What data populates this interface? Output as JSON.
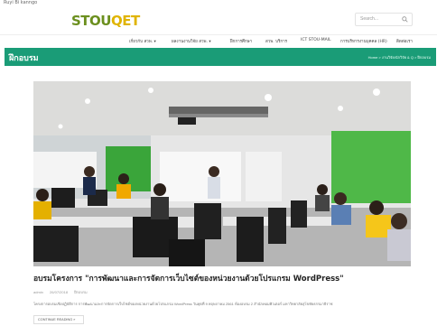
{
  "top_note": "Ruyi Bi kanngo",
  "logo": {
    "part1": "STOU",
    "part2": "QET"
  },
  "search": {
    "placeholder": "Search..."
  },
  "nav": {
    "items": [
      "เกี่ยวกับ สวพ. ▾",
      "ผลงานงานวิจัย สวพ. ▾",
      "ฝึกการศึกษา",
      "สวพ. บริการ",
      "ICT STOU-MAIL",
      "การบริหารงานบุคคล (HR)",
      "ติดต่อเรา"
    ]
  },
  "banner": {
    "title": "ฝึกอบรม",
    "breadcrumb": "Home > งานวิจัย/นักวิจัย & Q > ฝึกอบรม"
  },
  "post": {
    "title": "อบรมโครงการ \"การพัฒนาและการจัดการเว็บไซต์ของหน่วยงานด้วยโปรแกรม WordPress\"",
    "author": "admin",
    "date": "26/07/2018",
    "category": "ฝึกอบรม",
    "excerpt": "โครงการอบรมเชิงปฏิบัติการ การพัฒนาและการจัดการเว็บไซต์ของหน่วยงานด้วยโปรแกรม WordPress วันพุธที่ 9 พฤษภาคม 2561 ห้องอบรม 2 สำนักคอมพิวเตอร์ มหาวิทยาลัยสุโขทัยธรรมาธิราช",
    "read_more": "CONTINUE READING »"
  },
  "colors": {
    "accent": "#1a9c77",
    "logo_green": "#6b8f1e",
    "logo_yellow": "#e0b400"
  }
}
